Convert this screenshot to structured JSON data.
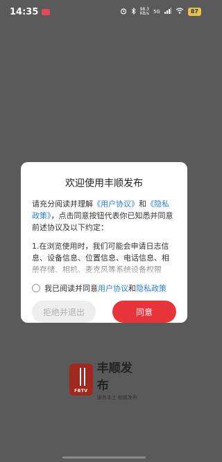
{
  "status_bar": {
    "time": "14:35",
    "net_speed_value": "98.3",
    "net_speed_unit": "KB/s",
    "network_type": "5G",
    "battery_level": "87",
    "icons": [
      "alarm-icon",
      "bluetooth-icon",
      "signal-icon",
      "wifi-icon",
      "battery-icon"
    ]
  },
  "dialog": {
    "title": "欢迎使用丰顺发布",
    "intro_part1": "请充分阅读并理解",
    "user_agreement_link": "《用户协议》",
    "intro_and": "和",
    "privacy_policy_link": "《隐私政策》",
    "intro_part2": "，点击同意按钮代表你已知悉并同意前述协议及以下约定：",
    "body_text": "1.在浏览使用时，我们可能会申请日志信息、设备信息、位置信息、电话信息、相册存储、相机、麦克风等系统设备权限",
    "checkbox_label_prefix": "我已阅读并同意",
    "checkbox_user_agreement": "用户协议",
    "checkbox_and": "和",
    "checkbox_privacy_policy": "隐私政策",
    "checkbox_checked": false,
    "reject_label": "拒绝并退出",
    "agree_label": "同意"
  },
  "splash": {
    "logo_badge": "FBTV",
    "app_name": "丰顺发布",
    "slogan": "服务本土 权威发布"
  },
  "colors": {
    "accent_red": "#e8333a",
    "link_blue": "#2b7fe0",
    "backdrop": "#5a5a5a"
  }
}
